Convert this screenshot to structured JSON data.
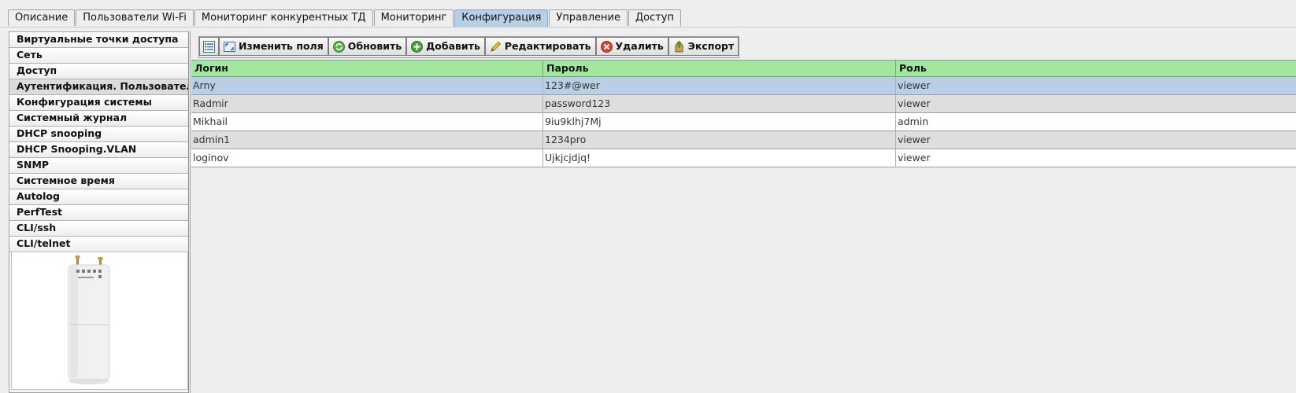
{
  "tabs": [
    {
      "label": "Описание"
    },
    {
      "label": "Пользователи Wi-Fi"
    },
    {
      "label": "Мониторинг конкурентных ТД"
    },
    {
      "label": "Мониторинг"
    },
    {
      "label": "Конфигурация"
    },
    {
      "label": "Управление"
    },
    {
      "label": "Доступ"
    }
  ],
  "active_tab": "Конфигурация",
  "sidebar": {
    "items": [
      {
        "label": "Виртуальные точки доступа"
      },
      {
        "label": "Сеть"
      },
      {
        "label": "Доступ"
      },
      {
        "label": "Аутентификация. Пользователи"
      },
      {
        "label": "Конфигурация системы"
      },
      {
        "label": "Системный журнал"
      },
      {
        "label": "DHCP snooping"
      },
      {
        "label": "DHCP Snooping.VLAN"
      },
      {
        "label": "SNMP"
      },
      {
        "label": "Системное время"
      },
      {
        "label": "Autolog"
      },
      {
        "label": "PerfTest"
      },
      {
        "label": "CLI/ssh"
      },
      {
        "label": "CLI/telnet"
      }
    ]
  },
  "toolbar": {
    "columns_icon": "list-view-icon",
    "edit_fields": "Изменить поля",
    "refresh": "Обновить",
    "add": "Добавить",
    "edit": "Редактировать",
    "delete": "Удалить",
    "export": "Экспорт"
  },
  "table": {
    "headers": [
      "Логин",
      "Пароль",
      "Роль"
    ],
    "rows": [
      [
        "Arny",
        "123#@wer",
        "viewer"
      ],
      [
        "Radmir",
        "password123",
        "viewer"
      ],
      [
        "Mikhail",
        "9iu9klhj7Mj",
        "admin"
      ],
      [
        "admin1",
        "1234pro",
        "viewer"
      ],
      [
        "loginov",
        "Ujkjcjdjq!",
        "viewer"
      ]
    ]
  },
  "colors": {
    "header_green": "#a3e79f",
    "selected_row": "#b8cfe5",
    "active_tab": "#b8cfe5"
  }
}
